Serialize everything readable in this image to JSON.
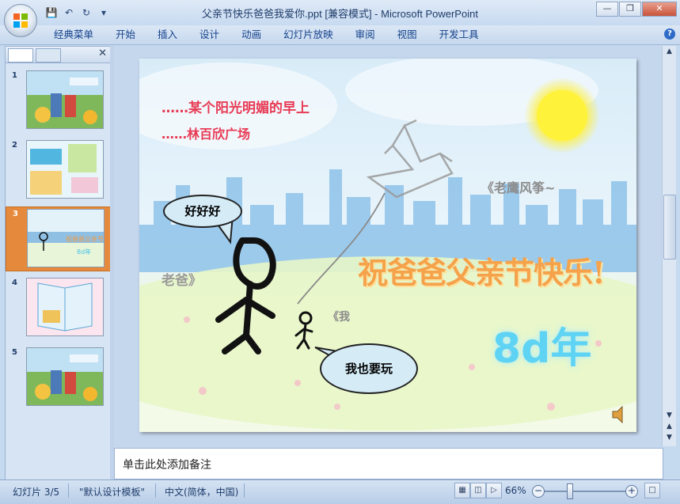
{
  "window": {
    "title": "父亲节快乐爸爸我爱你.ppt [兼容模式] - Microsoft PowerPoint"
  },
  "ribbon": {
    "tabs": [
      "经典菜单",
      "开始",
      "插入",
      "设计",
      "动画",
      "幻灯片放映",
      "审阅",
      "视图",
      "开发工具"
    ]
  },
  "thumbnails": {
    "items": [
      {
        "num": "1",
        "selected": false
      },
      {
        "num": "2",
        "selected": false
      },
      {
        "num": "3",
        "selected": true
      },
      {
        "num": "4",
        "selected": false
      },
      {
        "num": "5",
        "selected": false
      }
    ]
  },
  "slide": {
    "line1": "……某个阳光明媚的早上",
    "line2": "……林百欣广场",
    "kite_label": "《老鹰风筝~",
    "dad_label": "老爸》",
    "me_label": "《我",
    "bubble_dad": "好好好",
    "bubble_kid": "我也要玩",
    "main_title": "祝爸爸父亲节快乐!",
    "age": "8d年"
  },
  "notes": {
    "placeholder": "单击此处添加备注"
  },
  "status": {
    "slide_info": "幻灯片 3/5",
    "template": "\"默认设计模板\"",
    "language": "中文(简体，中国)",
    "zoom": "66%"
  },
  "colors": {
    "accent": "#e58a3c",
    "title_orange": "#f5a24a",
    "age_cyan": "#5fd3f3",
    "red_text": "#e83b55"
  }
}
